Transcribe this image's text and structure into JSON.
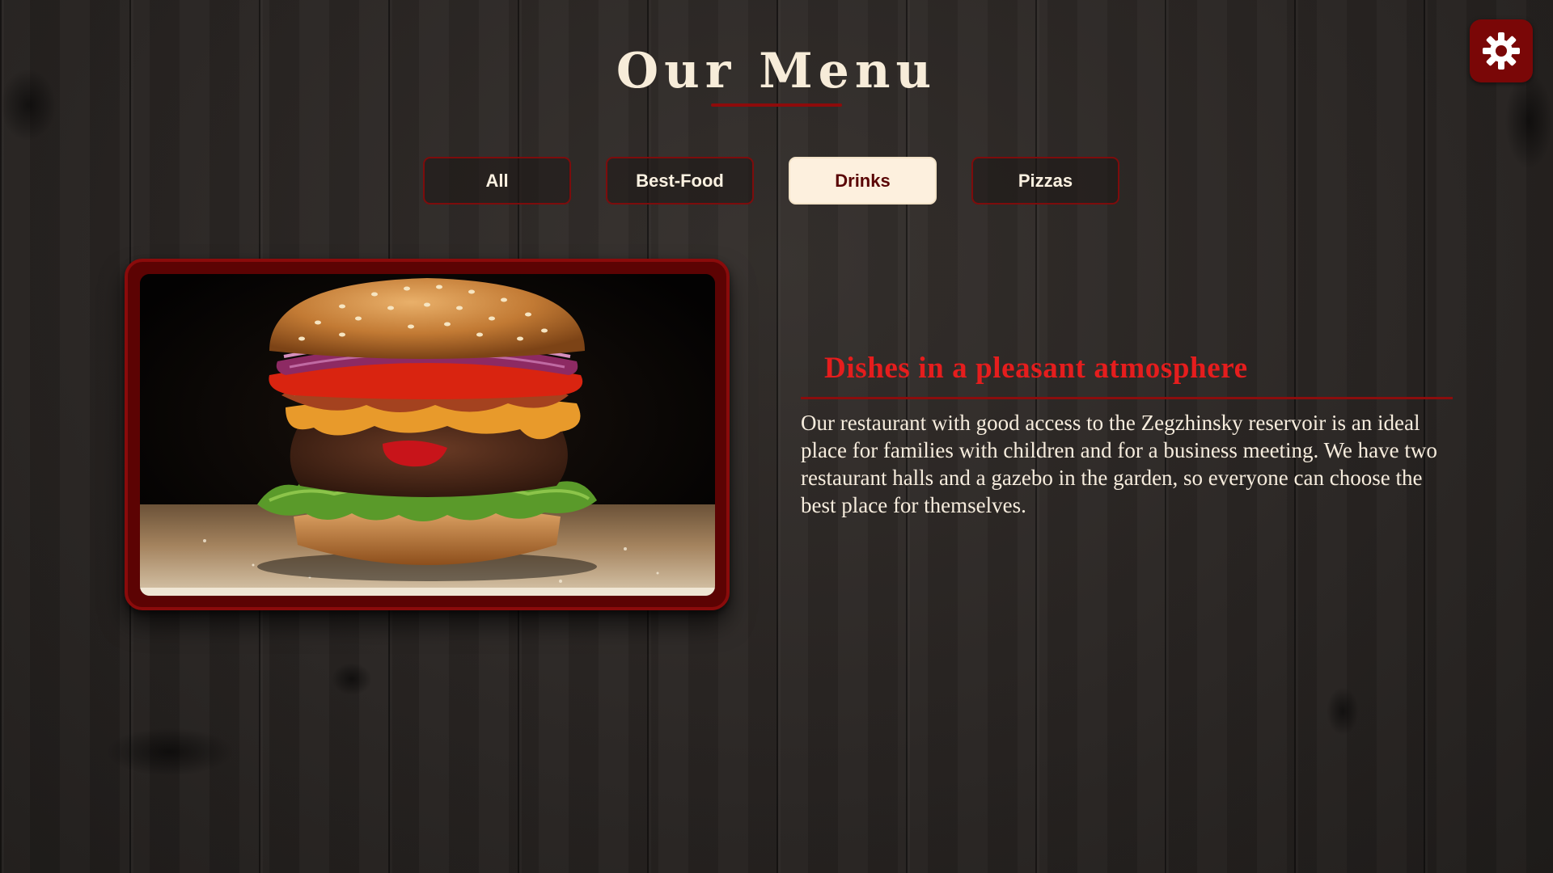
{
  "header": {
    "title": "Our Menu"
  },
  "settings": {
    "icon": "gear-icon"
  },
  "tabs": [
    {
      "label": "All",
      "active": false
    },
    {
      "label": "Best-Food",
      "active": false
    },
    {
      "label": "Drinks",
      "active": true
    },
    {
      "label": "Pizzas",
      "active": false
    }
  ],
  "featured": {
    "image": "burger-photo",
    "heading": "Dishes in a pleasant atmosphere",
    "description": "Our restaurant with good access to the Zegzhinsky reservoir is an ideal place for families with children and for a business meeting. We have two restaurant halls and a gazebo in the garden, so everyone can choose the best place for themselves."
  },
  "colors": {
    "accent": "#7a0707",
    "heading_red": "#e51d1d",
    "active_tab_bg": "#fdf0de",
    "text_light": "#f6ecdd"
  }
}
